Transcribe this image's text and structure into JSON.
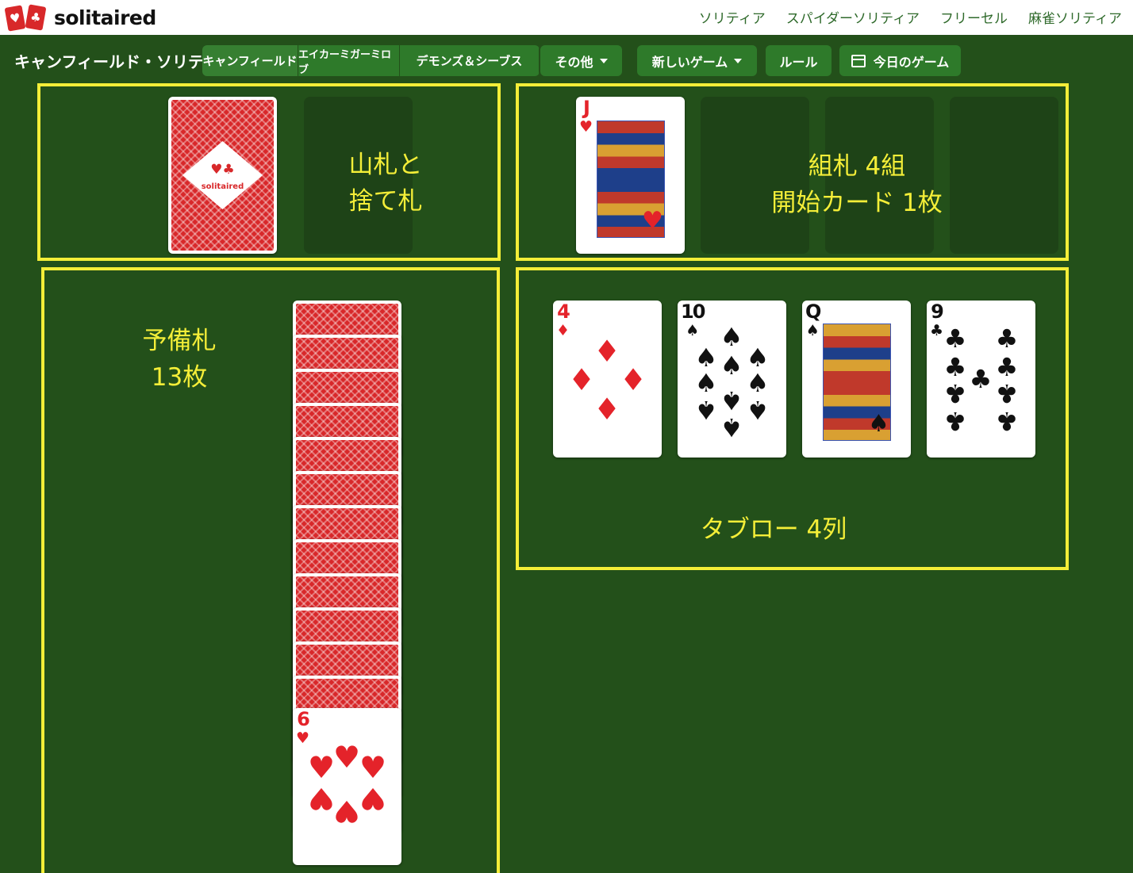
{
  "header": {
    "logo_text": "solitaired",
    "nav": [
      "ソリティア",
      "スパイダーソリティア",
      "フリーセル",
      "麻雀ソリティア"
    ]
  },
  "toolbar": {
    "game_title": "キャンフィールド・ソリティア",
    "variants": [
      "キャンフィールド",
      "エイカーミガーミロブ",
      "デモンズ＆シーブス"
    ],
    "more_label": "その他",
    "new_game_label": "新しいゲーム",
    "rules_label": "ルール",
    "daily_label": "今日のゲーム"
  },
  "labels": {
    "stock_waste": "山札と\n捨て札",
    "foundations": "組札 4組\n開始カード 1枚",
    "reserve": "予備札\n13枚",
    "tableau": "タブロー 4列"
  },
  "cards": {
    "foundation_start": {
      "rank": "J",
      "suit": "♥"
    },
    "tableau": [
      {
        "rank": "4",
        "suit": "♦"
      },
      {
        "rank": "10",
        "suit": "♠"
      },
      {
        "rank": "Q",
        "suit": "♠"
      },
      {
        "rank": "9",
        "suit": "♣"
      }
    ],
    "reserve_top": {
      "rank": "6",
      "suit": "♥"
    },
    "reserve_face_down": 12,
    "back_logo_text": "solitaired"
  },
  "colors": {
    "felt": "#23501a",
    "highlight": "#f4ee38",
    "button": "#2e7a2a",
    "card_red": "#e4232a",
    "card_back": "#d8282a"
  }
}
